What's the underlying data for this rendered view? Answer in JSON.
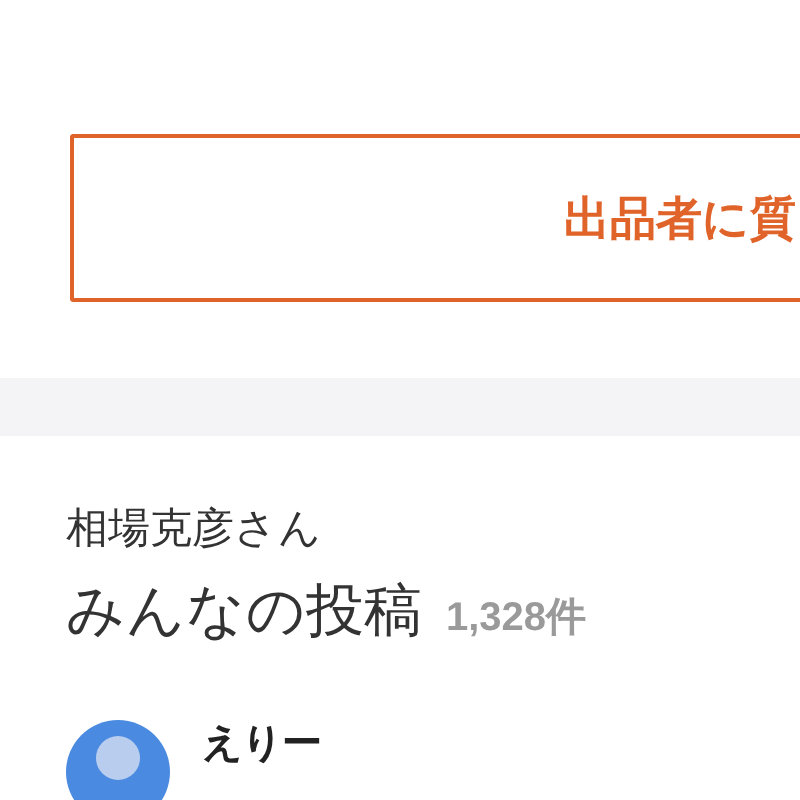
{
  "question_button": {
    "label": "出品者に質"
  },
  "posts": {
    "author": "相場克彦さん",
    "title": "みんなの投稿",
    "count": "1,328件"
  },
  "first_post": {
    "user": "えりー"
  }
}
